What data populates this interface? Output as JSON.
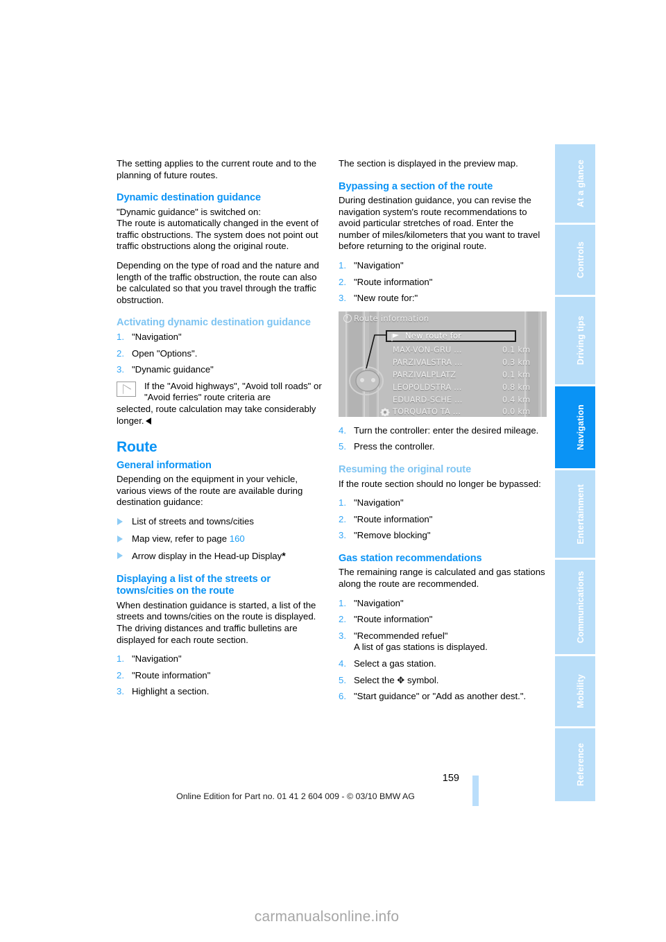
{
  "document": {
    "page_number": "159",
    "footer_note": "Online Edition for Part no. 01 41 2 604 009 - © 03/10 BMW AG",
    "watermark": "carmanualsonline.info",
    "colors": {
      "heading_blue": "#0a93f5",
      "subheading_blue": "#7ec4f2",
      "tab_inactive": "#b9def9",
      "tab_active": "#0a93f5",
      "link_blue": "#1a9df5"
    }
  },
  "tabs": [
    {
      "label": "At a glance",
      "active": false
    },
    {
      "label": "Controls",
      "active": false
    },
    {
      "label": "Driving tips",
      "active": false
    },
    {
      "label": "Navigation",
      "active": true
    },
    {
      "label": "Entertainment",
      "active": false
    },
    {
      "label": "Communications",
      "active": false
    },
    {
      "label": "Mobility",
      "active": false
    },
    {
      "label": "Reference",
      "active": false
    }
  ],
  "left_column": {
    "intro": "The setting applies to the current route and to the planning of future routes.",
    "dynamic_guidance": {
      "heading": "Dynamic destination guidance",
      "para1": "\"Dynamic guidance\" is switched on:",
      "para2": "The route is automatically changed in the event of traffic obstructions. The system does not point out traffic obstructions along the original route.",
      "para3": "Depending on the type of road and the nature and length of the traffic obstruction, the route can also be calculated so that you travel through the traffic obstruction."
    },
    "activating": {
      "heading": "Activating dynamic destination guidance",
      "steps": [
        {
          "num": "1.",
          "text": "\"Navigation\""
        },
        {
          "num": "2.",
          "text": "Open \"Options\"."
        },
        {
          "num": "3.",
          "text": "\"Dynamic guidance\""
        }
      ],
      "note_icon": "note-triangle-icon",
      "note_first_lines": "If the \"Avoid highways\", \"Avoid toll roads\" or \"Avoid ferries\" route criteria are",
      "note_rest": "selected, route calculation may take considerably longer."
    },
    "route": {
      "heading": "Route",
      "general_information": {
        "heading": "General information",
        "para": "Depending on the equipment in your vehicle, various views of the route are available during destination guidance:",
        "bullets": [
          {
            "text": "List of streets and towns/cities",
            "pageref": "",
            "asterisk": false
          },
          {
            "text": "Map view, refer to page ",
            "pageref": "160",
            "asterisk": false
          },
          {
            "text": "Arrow display in the Head-up Display",
            "pageref": "",
            "asterisk": true
          }
        ]
      },
      "displaying_list": {
        "heading": "Displaying a list of the streets or towns/cities on the route",
        "para": "When destination guidance is started, a list of the streets and towns/cities on the route is displayed. The driving distances and traffic bulletins are displayed for each route section.",
        "steps": [
          {
            "num": "1.",
            "text": "\"Navigation\""
          },
          {
            "num": "2.",
            "text": "\"Route information\""
          },
          {
            "num": "3.",
            "text": "Highlight a section."
          }
        ]
      }
    }
  },
  "right_column": {
    "intro": "The section is displayed in the preview map.",
    "bypassing": {
      "heading": "Bypassing a section of the route",
      "para": "During destination guidance, you can revise the navigation system's route recommendations to avoid particular stretches of road. Enter the number of miles/kilometers that you want to travel before returning to the original route.",
      "steps_before": [
        {
          "num": "1.",
          "text": "\"Navigation\""
        },
        {
          "num": "2.",
          "text": "\"Route information\""
        },
        {
          "num": "3.",
          "text": "\"New route for:\""
        }
      ],
      "steps_after": [
        {
          "num": "4.",
          "text": "Turn the controller: enter the desired mileage."
        },
        {
          "num": "5.",
          "text": "Press the controller."
        }
      ]
    },
    "resuming": {
      "heading": "Resuming the original route",
      "para": "If the route section should no longer be bypassed:",
      "steps": [
        {
          "num": "1.",
          "text": "\"Navigation\""
        },
        {
          "num": "2.",
          "text": "\"Route information\""
        },
        {
          "num": "3.",
          "text": "\"Remove blocking\""
        }
      ]
    },
    "gas_station": {
      "heading": "Gas station recommendations",
      "para": "The remaining range is calculated and gas stations along the route are recommended.",
      "steps": [
        {
          "num": "1.",
          "text": "\"Navigation\"",
          "sub": ""
        },
        {
          "num": "2.",
          "text": "\"Route information\"",
          "sub": ""
        },
        {
          "num": "3.",
          "text": "\"Recommended refuel\"",
          "sub": "A list of gas stations is displayed."
        },
        {
          "num": "4.",
          "text": "Select a gas station.",
          "sub": ""
        },
        {
          "num": "5.",
          "text": "Select the ✥ symbol.",
          "sub": ""
        },
        {
          "num": "6.",
          "text": "\"Start guidance\" or \"Add as another dest.\".",
          "sub": ""
        }
      ]
    }
  },
  "nav_screenshot": {
    "title": "Route information",
    "highlight_row": "New route for",
    "rows": [
      {
        "name": "MAX-VON-GRU ...",
        "distance": "0.1 km",
        "icon": ""
      },
      {
        "name": "PARZIVALSTRA ...",
        "distance": "0.3 km",
        "icon": ""
      },
      {
        "name": "PARZIVALPLATZ",
        "distance": "0.1 km",
        "icon": ""
      },
      {
        "name": "LEOPOLDSTRA ...",
        "distance": "0.8 km",
        "icon": ""
      },
      {
        "name": "EDUARD-SCHE ...",
        "distance": "0.4 km",
        "icon": ""
      },
      {
        "name": "TORQUATO TA ...",
        "distance": "0.0 km",
        "icon": "destination-flag-icon"
      }
    ]
  }
}
